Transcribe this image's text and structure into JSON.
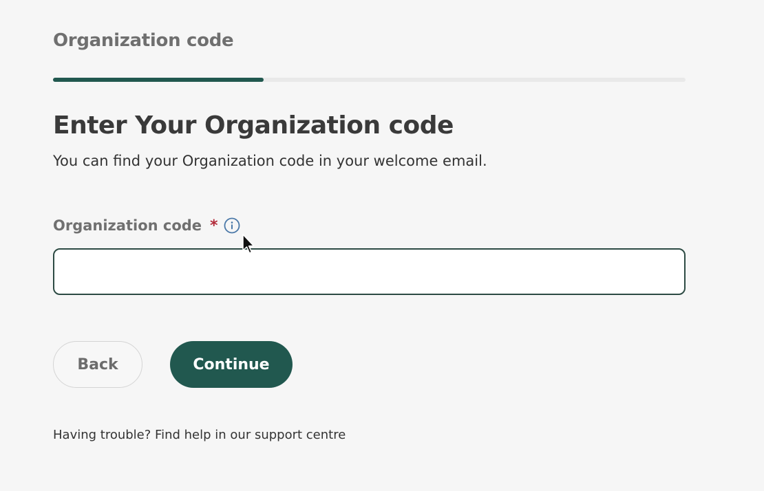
{
  "header": {
    "step_title": "Organization code",
    "progress_fraction": 0.333
  },
  "main": {
    "heading": "Enter Your Organization code",
    "subtext": "You can find your Organization code in your welcome email.",
    "field": {
      "label": "Organization code",
      "required_mark": "*",
      "info_icon": "info-circle-icon",
      "value": "",
      "placeholder": ""
    },
    "buttons": {
      "back_label": "Back",
      "continue_label": "Continue"
    },
    "help": {
      "prefix": "Having trouble?",
      "link_label": "Find help in our support centre"
    }
  },
  "colors": {
    "accent": "#21584f",
    "required": "#b32b3a",
    "info": "#4a78a8",
    "background": "#f6f6f6"
  }
}
